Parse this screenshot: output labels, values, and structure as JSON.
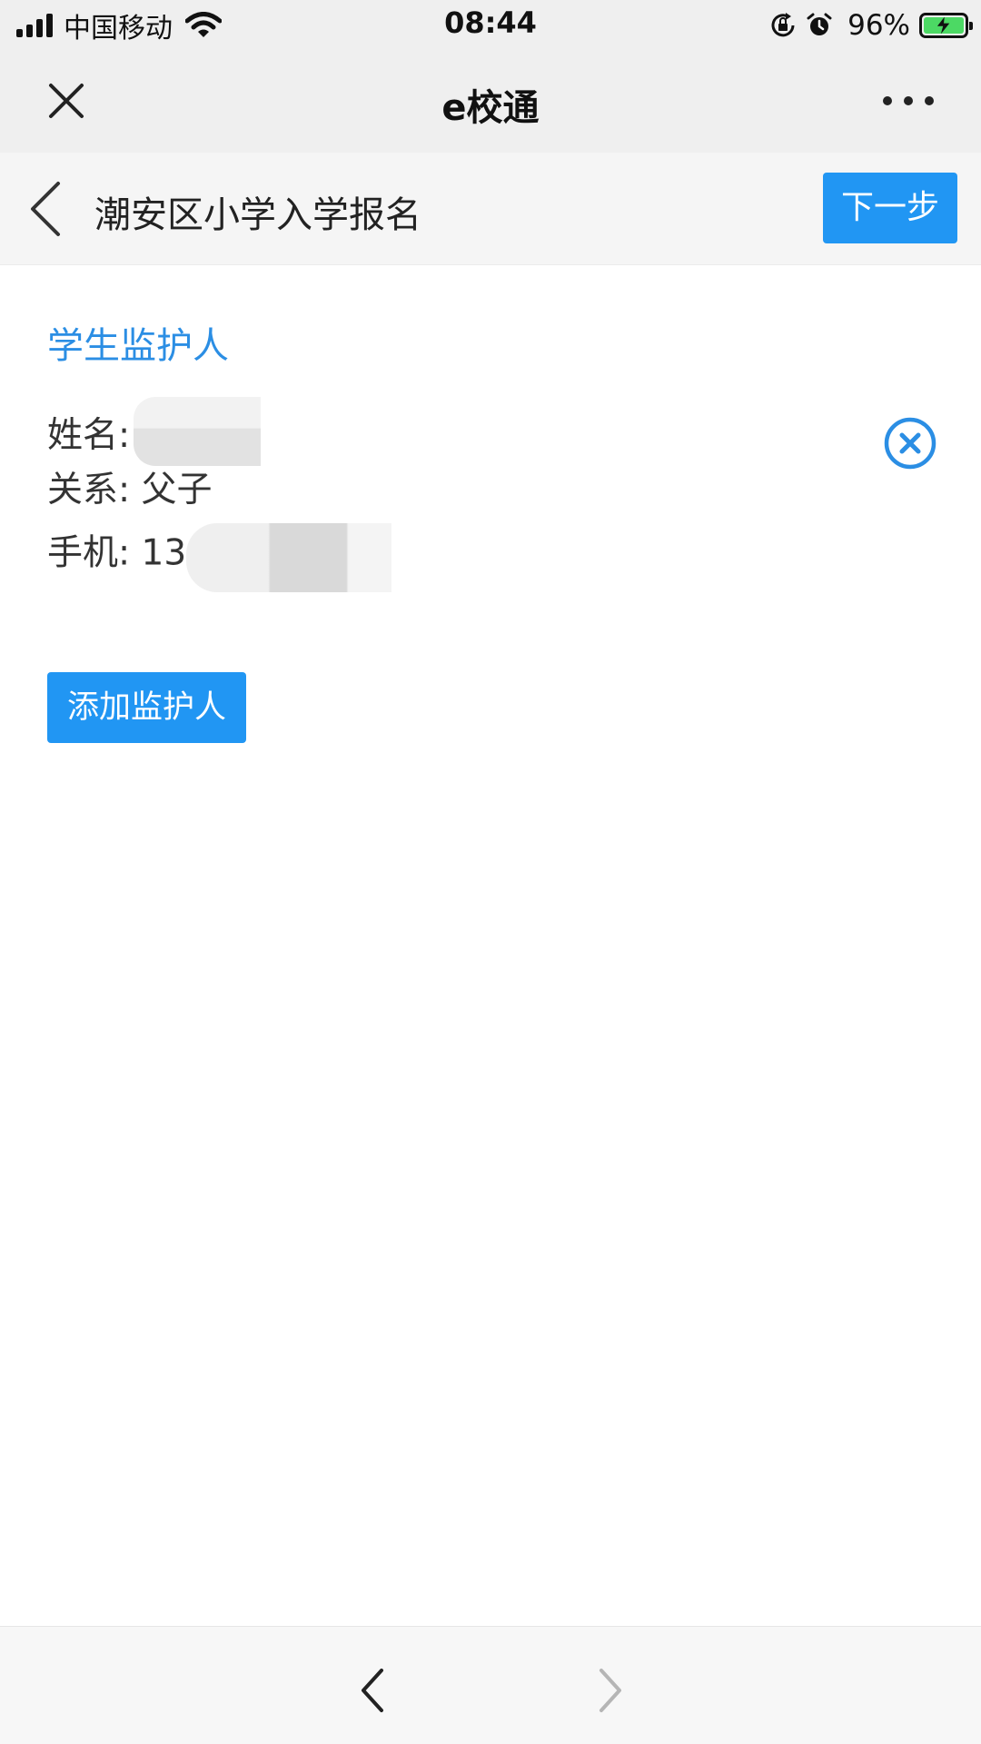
{
  "status_bar": {
    "carrier": "中国移动",
    "time": "08:44",
    "battery_percent": "96%",
    "icons": [
      "signal-icon",
      "wifi-icon",
      "rotation-lock-icon",
      "alarm-icon",
      "battery-charging-icon"
    ]
  },
  "wechat_header": {
    "title": "e校通",
    "icons": [
      "close-icon",
      "more-icon"
    ]
  },
  "page_header": {
    "title": "潮安区小学入学报名",
    "next_label": "下一步",
    "icons": [
      "back-chevron-icon"
    ]
  },
  "section": {
    "title": "学生监护人"
  },
  "guardian": {
    "name_label": "姓名:",
    "relation_label": "关系:",
    "relation_value": "父子",
    "phone_label": "手机:",
    "phone_visible": "13",
    "icons": [
      "remove-circle-icon"
    ]
  },
  "actions": {
    "add_guardian_label": "添加监护人"
  },
  "colors": {
    "accent": "#2196f3",
    "section_title": "#2b8ee4",
    "header_bg": "#efefef",
    "battery_green": "#4cd964"
  },
  "bottom_nav": {
    "icons": [
      "nav-back-icon",
      "nav-forward-icon"
    ]
  }
}
